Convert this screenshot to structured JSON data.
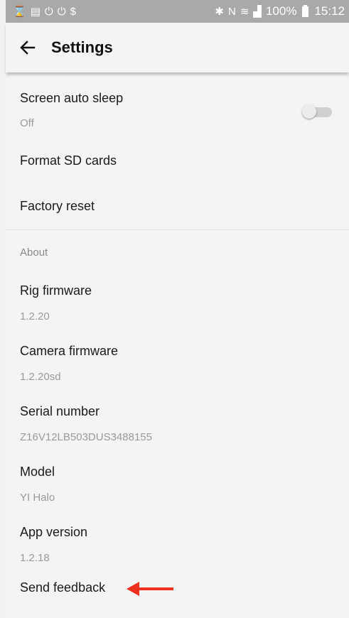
{
  "status_bar": {
    "left_icons": [
      "hourglass-icon",
      "cast-icon",
      "bag-icon",
      "bag-icon",
      "s-logo-icon"
    ],
    "right_icons": [
      "bluetooth-icon",
      "nfc-icon",
      "wifi-icon",
      "signal-icon"
    ],
    "battery": "100%",
    "time": "15:12"
  },
  "appbar": {
    "title": "Settings",
    "back_icon": "back-arrow-icon"
  },
  "settings": {
    "screen_auto_sleep": {
      "label": "Screen auto sleep",
      "value": "Off",
      "toggle_on": false
    },
    "format_sd": {
      "label": "Format SD cards"
    },
    "factory_reset": {
      "label": "Factory reset"
    }
  },
  "about": {
    "header": "About",
    "items": [
      {
        "label": "Rig firmware",
        "value": "1.2.20"
      },
      {
        "label": "Camera firmware",
        "value": "1.2.20sd"
      },
      {
        "label": "Serial number",
        "value": "Z16V12LB503DUS3488155"
      },
      {
        "label": "Model",
        "value": "YI Halo"
      },
      {
        "label": "App version",
        "value": "1.2.18"
      }
    ],
    "send_feedback": {
      "label": "Send feedback"
    }
  },
  "colors": {
    "annotation_arrow": "#f0301e",
    "status_bar": "#a9a9a9"
  }
}
